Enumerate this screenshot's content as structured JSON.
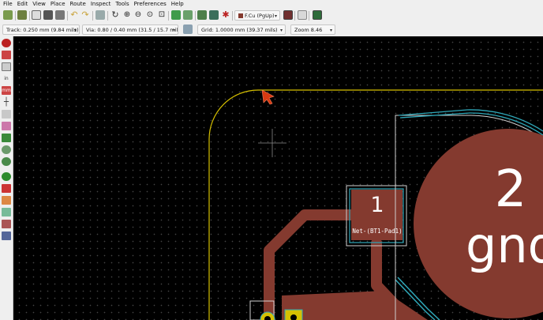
{
  "menu": [
    "File",
    "Edit",
    "View",
    "Place",
    "Route",
    "Inspect",
    "Tools",
    "Preferences",
    "Help"
  ],
  "toolbar": {
    "layer_select": "F.Cu (PgUp)",
    "track_select": "Track: 0.250 mm (9.84 mils) *",
    "via_select": "Via: 0.80 / 0.40 mm (31.5 / 15.7 mils) *",
    "grid_select": "Grid: 1.0000 mm (39.37 mils)",
    "zoom_select": "Zoom 8.46"
  },
  "board": {
    "pad1_number": "1",
    "pad1_net": "Net-(BT1-Pad1)",
    "pad2_number": "2",
    "pad2_net": "gnd"
  },
  "colors": {
    "copper": "#843a2f",
    "edge_cuts": "#d6c000",
    "pad_outline": "#2fa7b8",
    "courtyard": "#cfcfcf",
    "cursor": "#d83a12"
  }
}
